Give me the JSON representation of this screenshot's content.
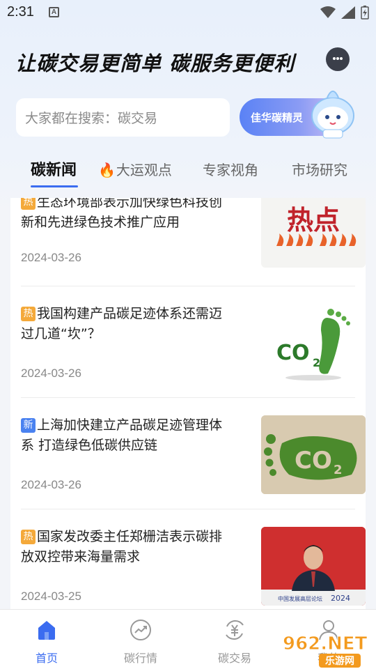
{
  "status_bar": {
    "time": "2:31",
    "notification_letter": "A"
  },
  "header": {
    "slogan": "让碳交易更简单 碳服务更便利"
  },
  "search": {
    "placeholder": "大家都在搜索：碳交易"
  },
  "assistant": {
    "label": "佳华碳精灵"
  },
  "tabs": [
    {
      "label": "碳新闻",
      "active": true
    },
    {
      "label": "大运观点",
      "active": false
    },
    {
      "label": "专家视角",
      "active": false
    },
    {
      "label": "市场研究",
      "active": false
    }
  ],
  "news": [
    {
      "tag": "热",
      "tag_type": "hot",
      "title": "生态环境部表示加快绿色科技创新和先进绿色技术推广应用",
      "date": "2024-03-26",
      "thumb": "hot-topic"
    },
    {
      "tag": "热",
      "tag_type": "hot",
      "title": "我国构建产品碳足迹体系还需迈过几道“坎”？",
      "date": "2024-03-26",
      "thumb": "co2-footprint-green"
    },
    {
      "tag": "新",
      "tag_type": "new",
      "title": "上海加快建立产品碳足迹管理体系 打造绿色低碳供应链",
      "date": "2024-03-26",
      "thumb": "co2-grass-footprint"
    },
    {
      "tag": "热",
      "tag_type": "hot",
      "title": "国家发改委主任郑栅洁表示碳排放双控带来海量需求",
      "date": "2024-03-25",
      "thumb": "speaker-photo"
    }
  ],
  "thumb_text": {
    "hot_topic": "热点",
    "co2": "CO",
    "co2_sub": "2",
    "forum": "中国发展高层论坛",
    "forum_year": "2024"
  },
  "nav": [
    {
      "label": "首页",
      "icon": "home-icon",
      "active": true
    },
    {
      "label": "碳行情",
      "icon": "trend-icon",
      "active": false
    },
    {
      "label": "碳交易",
      "icon": "yuan-exchange-icon",
      "active": false
    },
    {
      "label": "我的",
      "icon": "user-icon",
      "active": false
    }
  ],
  "watermark": {
    "brand": "962.NET",
    "site": "乐游网"
  },
  "colors": {
    "accent": "#3b6cf0",
    "hot_tag": "#f4a93a",
    "new_tag": "#4a82f0"
  }
}
